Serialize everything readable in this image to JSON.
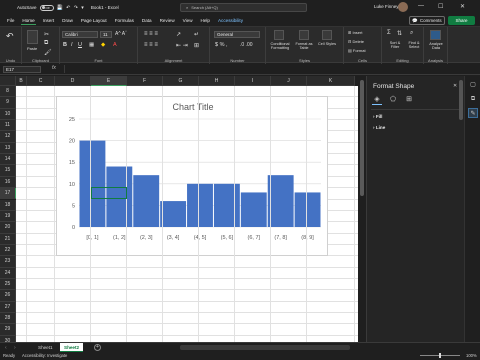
{
  "titlebar": {
    "autosave_label": "AutoSave",
    "autosave_state": "Off",
    "doc_title": "Book1 - Excel",
    "search_placeholder": "Search (Alt+Q)",
    "user_name": "Luke Finney"
  },
  "menu": [
    "File",
    "Home",
    "Insert",
    "Draw",
    "Page Layout",
    "Formulas",
    "Data",
    "Review",
    "View",
    "Help",
    "Accessibility"
  ],
  "menu_active": "Home",
  "actions": {
    "comments": "Comments",
    "share": "Share"
  },
  "ribbon": {
    "undo": "Undo",
    "clipboard": {
      "label": "Clipboard",
      "paste": "Paste"
    },
    "font": {
      "label": "Font",
      "name": "Calibri",
      "size": "11"
    },
    "alignment": {
      "label": "Alignment"
    },
    "number": {
      "label": "Number",
      "format": "General"
    },
    "styles": {
      "label": "Styles",
      "cond": "Conditional Formatting",
      "table": "Format as Table",
      "cell": "Cell Styles"
    },
    "cells": {
      "label": "Cells",
      "insert": "Insert",
      "delete": "Delete",
      "format": "Format"
    },
    "editing": {
      "label": "Editing",
      "sort": "Sort & Filter",
      "find": "Find & Select"
    },
    "analysis": {
      "label": "Analysis",
      "analyze": "Analyze Data"
    }
  },
  "formula_bar": {
    "name_box": "E17",
    "fx": "fx",
    "value": ""
  },
  "columns": [
    "B",
    "C",
    "D",
    "E",
    "F",
    "G",
    "H",
    "I",
    "J",
    "K"
  ],
  "rows": [
    "8",
    "9",
    "10",
    "11",
    "12",
    "13",
    "14",
    "15",
    "16",
    "17",
    "18",
    "19",
    "20",
    "21",
    "22",
    "23",
    "24",
    "25",
    "26",
    "27",
    "28",
    "29",
    "30",
    "31",
    "32"
  ],
  "selected_cell": "E17",
  "chart_data": {
    "type": "bar",
    "title": "Chart Title",
    "categories": [
      "[0, 1]",
      "(1, 2]",
      "(2, 3]",
      "(3, 4]",
      "(4, 5]",
      "(5, 6]",
      "(6, 7]",
      "(7, 8]",
      "(8, 9]"
    ],
    "values": [
      20,
      14,
      12,
      6,
      10,
      10,
      8,
      12,
      8
    ],
    "yticks": [
      0,
      5,
      10,
      15,
      20,
      25
    ],
    "ylim": [
      0,
      25
    ],
    "bar_color": "#4472c4",
    "grid": true
  },
  "pane": {
    "title": "Format Shape",
    "sections": [
      "Fill",
      "Line"
    ]
  },
  "sheets": [
    "Sheet1",
    "Sheet2"
  ],
  "active_sheet": "Sheet2",
  "status": {
    "ready": "Ready",
    "accessibility": "Accessibility: Investigate",
    "zoom": "100%"
  }
}
